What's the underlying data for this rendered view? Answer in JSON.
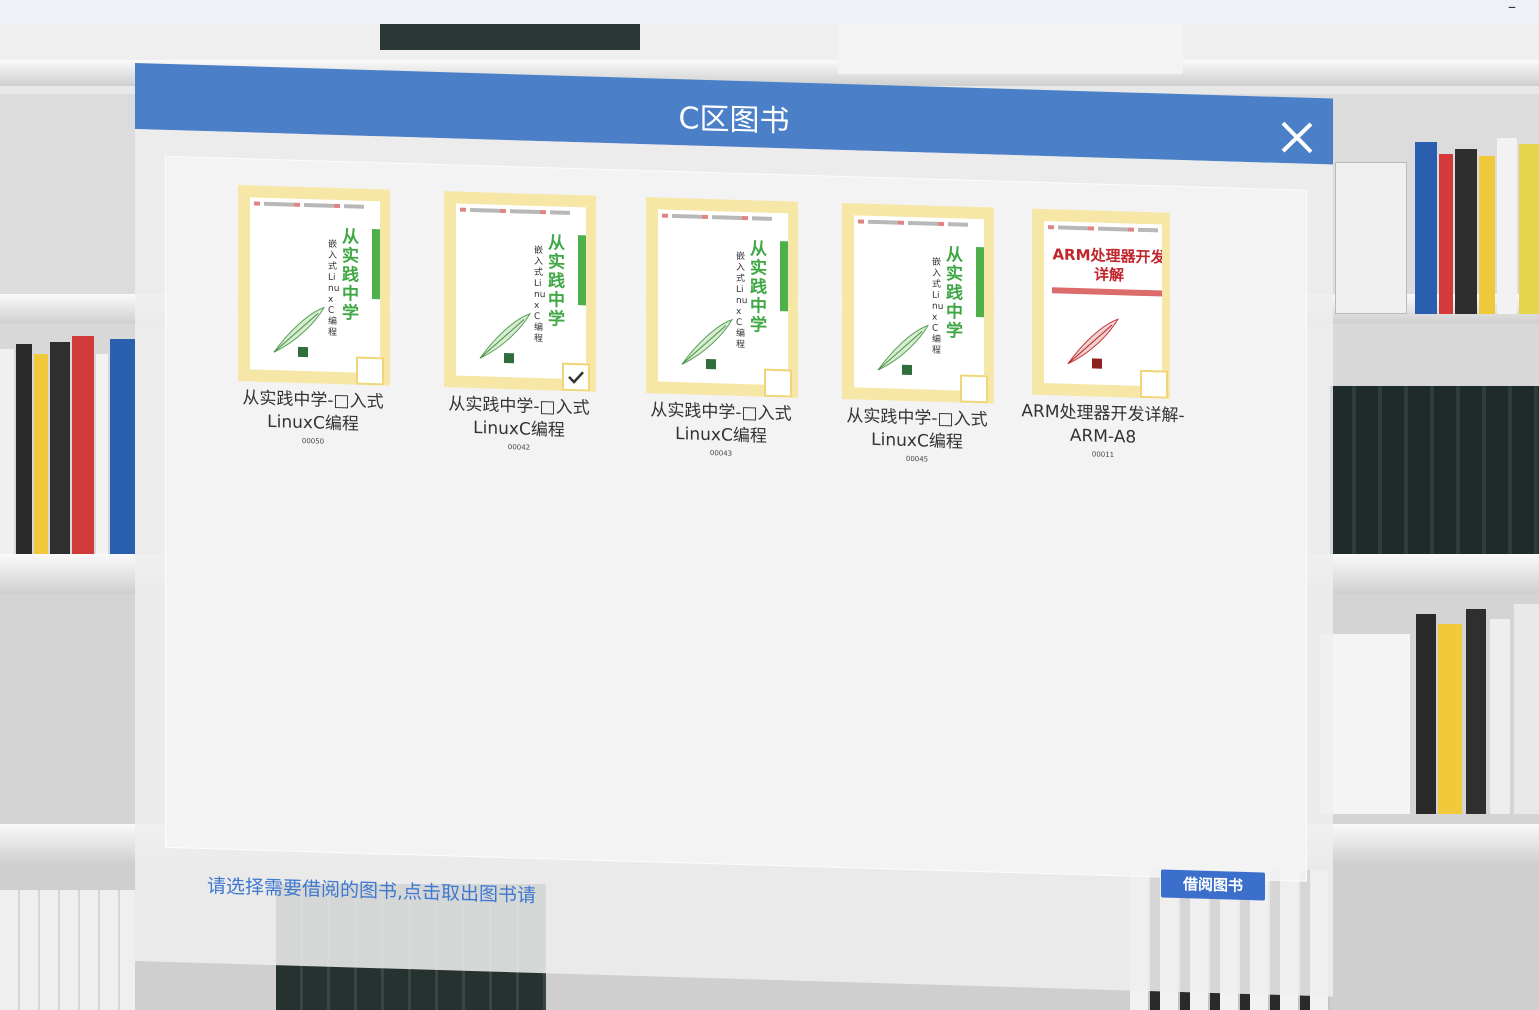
{
  "window": {
    "minimize_label": "–"
  },
  "dialog": {
    "title": "C区图书",
    "close_icon": "close-icon",
    "hint": "请选择需要借阅的图书,点击取出图书请",
    "borrow_button": "借阅图书"
  },
  "books": [
    {
      "name": "从实践中学-□入式LinuxC编程",
      "code": "00050",
      "checked": false,
      "cover_title": "从实践中学",
      "cover_subtitle": "嵌入式Linux C编程"
    },
    {
      "name": "从实践中学-□入式LinuxC编程",
      "code": "00042",
      "checked": true,
      "cover_title": "从实践中学",
      "cover_subtitle": "嵌入式Linux C编程"
    },
    {
      "name": "从实践中学-□入式LinuxC编程",
      "code": "00043",
      "checked": false,
      "cover_title": "从实践中学",
      "cover_subtitle": "嵌入式Linux C编程"
    },
    {
      "name": "从实践中学-□入式LinuxC编程",
      "code": "00045",
      "checked": false,
      "cover_title": "从实践中学",
      "cover_subtitle": "嵌入式Linux C编程"
    },
    {
      "name": "ARM处理器开发详解-ARM-A8",
      "code": "00011",
      "checked": false,
      "cover_title": "ARM处理器开发详解",
      "cover_subtitle": ""
    }
  ],
  "colors": {
    "header": "#4b80c9",
    "accent_text": "#3f78d0",
    "button": "#3b6fcb",
    "frame": "#f6e7a6"
  }
}
